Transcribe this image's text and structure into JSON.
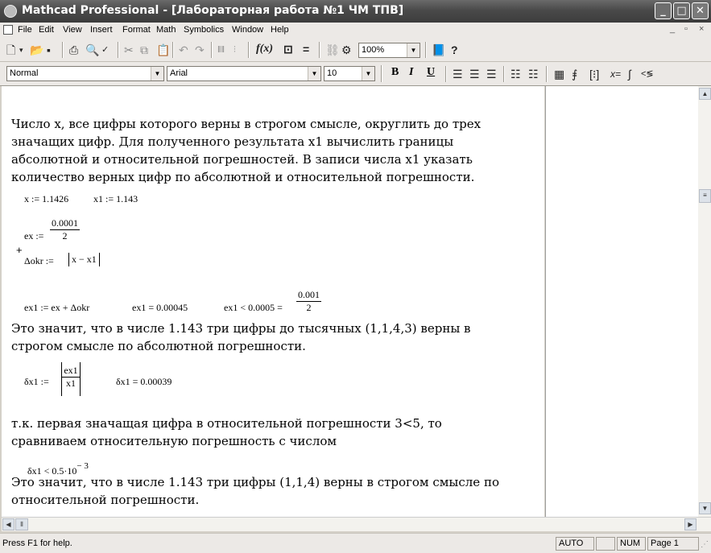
{
  "window": {
    "title": "Mathcad Professional - [Лабораторная работа №1 ЧМ ТПВ]",
    "minimize_icon": "minimize-icon",
    "maximize_icon": "maximize-icon",
    "close_icon": "close-icon"
  },
  "menu": {
    "items": [
      "File",
      "Edit",
      "View",
      "Insert",
      "Format",
      "Math",
      "Symbolics",
      "Window",
      "Help"
    ],
    "mdi_buttons": [
      "_",
      "▫",
      "×"
    ]
  },
  "toolbar": {
    "zoom": "100%"
  },
  "format_toolbar": {
    "style": "Normal",
    "font": "Arial",
    "size": "10",
    "bold": "B",
    "italic": "I",
    "underline": "U"
  },
  "document": {
    "p1": [
      "Число x, все цифры которого верны в строгом смысле, округлить до трех",
      "значащих цифр. Для полученного результата x1 вычислить границы",
      "абсолютной и относительной погрешностей. В записи числа x1 указать",
      "количество верных цифр по абсолютной и относительной погрешности."
    ],
    "eq1a": "x := 1.1426",
    "eq1b": "x1 := 1.143",
    "ex_lhs": "ex :=",
    "ex_num": "0.0001",
    "ex_den": "2",
    "dokr_lhs": "Δokr :=",
    "dokr_abs": "x − x1",
    "ex1_def": "ex1 := ex + Δokr",
    "ex1_val": "ex1 = 0.00045",
    "ex1_cmp": "ex1 < 0.0005 =",
    "ex1_cmp_num": "0.001",
    "ex1_cmp_den": "2",
    "p2": [
      "Это значит, что в числе 1.143 три цифры до тысячных (1,1,4,3) верны в",
      "строгом смысле по абсолютной погрешности."
    ],
    "dx1_lhs": "δx1 :=",
    "dx1_num": "ex1",
    "dx1_den": "x1",
    "dx1_val": "δx1 = 0.00039",
    "p3": [
      "т.к. первая значащая цифра в относительной погрешности 3<5, то",
      "сравниваем относительную погрешность с числом"
    ],
    "dx1_cmp": "δx1 < 0.5·10",
    "dx1_cmp_exp": "− 3",
    "p4": [
      "Это значит, что в числе 1.143 три цифры (1,1,4) верны в строгом смысле по",
      "относительной погрешности."
    ]
  },
  "status": {
    "help": "Press F1 for help.",
    "mode": "AUTO",
    "num": "NUM",
    "page": "Page 1"
  }
}
